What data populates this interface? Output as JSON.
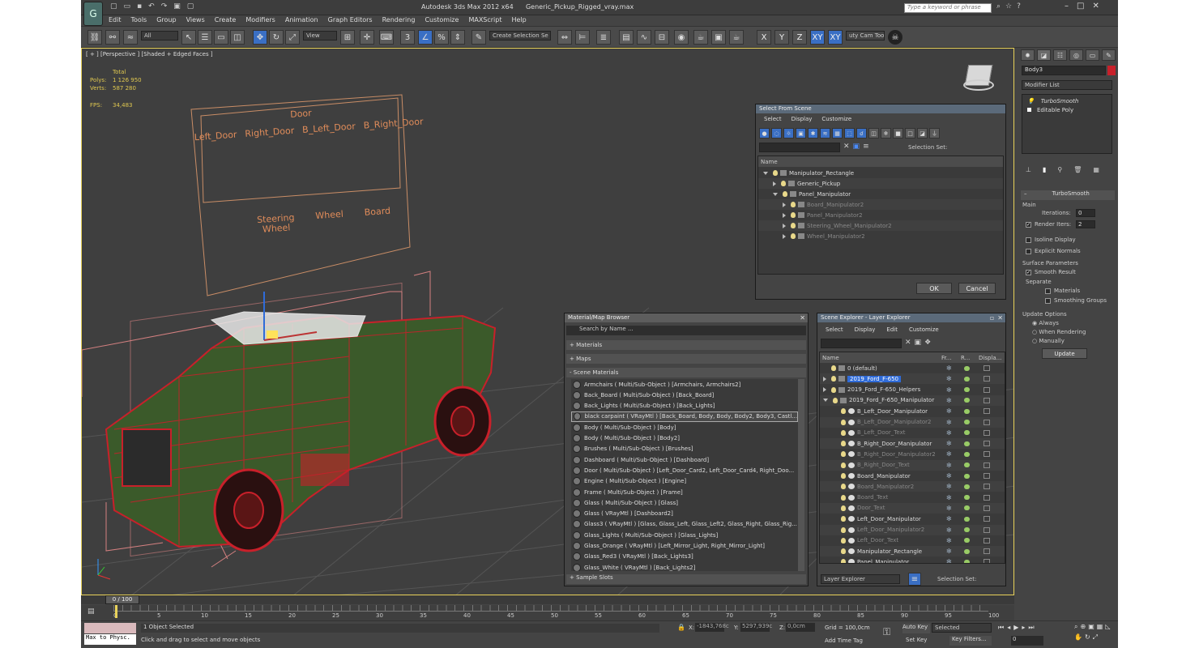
{
  "app": {
    "title": "Autodesk 3ds Max  2012 x64",
    "file": "Generic_Pickup_Rigged_vray.max",
    "search_placeholder": "Type a keyword or phrase"
  },
  "menu": [
    "Edit",
    "Tools",
    "Group",
    "Views",
    "Create",
    "Modifiers",
    "Animation",
    "Graph Editors",
    "Rendering",
    "Customize",
    "MAXScript",
    "Help"
  ],
  "toolbar": {
    "filter": "All",
    "refcoord": "View",
    "selset": "Create Selection Se",
    "axes": [
      "X",
      "Y",
      "Z",
      "XY",
      "XY"
    ],
    "cam_tool": "uty Cam Tool",
    "snap": "3"
  },
  "viewport": {
    "label": "[ + ] [Perspective ] [Shaded + Edged Faces ]",
    "stats": {
      "total": "Total",
      "polys_label": "Polys:",
      "polys": "1 126 950",
      "verts_label": "Verts:",
      "verts": "587 280",
      "fps_label": "FPS:",
      "fps": "34,483"
    },
    "panel": {
      "door": "Door",
      "labels": [
        "Left_Door",
        "Right_Door",
        "B_Left_Door",
        "B_Right_Door"
      ],
      "lower": [
        "Steering\nWheel",
        "Wheel",
        "Board"
      ]
    }
  },
  "select_scene": {
    "title": "Select From Scene",
    "menu": [
      "Select",
      "Display",
      "Customize"
    ],
    "selset": "Selection Set:",
    "col": "Name",
    "items": [
      {
        "n": "Manipulator_Rectangle",
        "d": 0,
        "g": false,
        "o": "down"
      },
      {
        "n": "Generic_Pickup",
        "d": 1,
        "g": false,
        "o": "right"
      },
      {
        "n": "Panel_Manipulator",
        "d": 1,
        "g": false,
        "o": "down"
      },
      {
        "n": "Board_Manipulator2",
        "d": 2,
        "g": true,
        "o": "right"
      },
      {
        "n": "Panel_Manipulator2",
        "d": 2,
        "g": true,
        "o": "right"
      },
      {
        "n": "Steering_Wheel_Manipulator2",
        "d": 2,
        "g": true,
        "o": "right"
      },
      {
        "n": "Wheel_Manipulator2",
        "d": 2,
        "g": true,
        "o": "right"
      }
    ],
    "ok": "OK",
    "cancel": "Cancel"
  },
  "mat_browser": {
    "title": "Material/Map Browser",
    "search": "Search by Name ...",
    "sections": [
      "+ Materials",
      "+ Maps",
      "- Scene Materials"
    ],
    "slots": "+ Sample Slots",
    "items": [
      "Armchairs  ( Multi/Sub-Object ) [Armchairs, Armchairs2]",
      "Back_Board  ( Multi/Sub-Object ) [Back_Board]",
      "Back_Lights  ( Multi/Sub-Object ) [Back_Lights]",
      "black carpaint  ( VRayMtl ) [Back_Board, Body, Body, Body2, Body3, Castl...",
      "Body  ( Multi/Sub-Object ) [Body]",
      "Body  ( Multi/Sub-Object ) [Body2]",
      "Brushes  ( Multi/Sub-Object ) [Brushes]",
      "Dashboard  ( Multi/Sub-Object ) [Dashboard]",
      "Door  ( Multi/Sub-Object ) [Left_Door_Card2, Left_Door_Card4, Right_Doo...",
      "Engine  ( Multi/Sub-Object ) [Engine]",
      "Frame  ( Multi/Sub-Object ) [Frame]",
      "Glass  ( Multi/Sub-Object ) [Glass]",
      "Glass  ( VRayMtl ) [Dashboard2]",
      "Glass3  ( VRayMtl ) [Glass, Glass_Left, Glass_Left2, Glass_Right, Glass_Rig...",
      "Glass_Lights  ( Multi/Sub-Object ) [Glass_Lights]",
      "Glass_Orange  ( VRayMtl ) [Left_Mirror_Light, Right_Mirror_Light]",
      "Glass_Red3  ( VRayMtl ) [Back_Lights3]",
      "Glass_White  ( VRayMtl ) [Back_Lights2]"
    ]
  },
  "scene_explorer": {
    "title": "Scene Explorer - Layer Explorer",
    "menu": [
      "Select",
      "Display",
      "Edit",
      "Customize"
    ],
    "cols": [
      "Name",
      "Fr...",
      "R...",
      "Displa..."
    ],
    "items": [
      {
        "n": "0 (default)",
        "d": 0,
        "t": "layer",
        "g": false,
        "o": ""
      },
      {
        "n": "2019_Ford_F-650",
        "d": 0,
        "t": "layer",
        "g": false,
        "o": "right",
        "sel": true
      },
      {
        "n": "2019_Ford_F-650_Helpers",
        "d": 0,
        "t": "layer",
        "g": false,
        "o": "right"
      },
      {
        "n": "2019_Ford_F-650_Manipulator",
        "d": 0,
        "t": "layer",
        "g": false,
        "o": "down"
      },
      {
        "n": "B_Left_Door_Manipulator",
        "d": 1,
        "t": "obj",
        "g": false,
        "o": ""
      },
      {
        "n": "B_Left_Door_Manipulator2",
        "d": 1,
        "t": "obj",
        "g": true,
        "o": ""
      },
      {
        "n": "B_Left_Door_Text",
        "d": 1,
        "t": "obj",
        "g": true,
        "o": ""
      },
      {
        "n": "B_Right_Door_Manipulator",
        "d": 1,
        "t": "obj",
        "g": false,
        "o": ""
      },
      {
        "n": "B_Right_Door_Manipulator2",
        "d": 1,
        "t": "obj",
        "g": true,
        "o": ""
      },
      {
        "n": "B_Right_Door_Text",
        "d": 1,
        "t": "obj",
        "g": true,
        "o": ""
      },
      {
        "n": "Board_Manipulator",
        "d": 1,
        "t": "obj",
        "g": false,
        "o": ""
      },
      {
        "n": "Board_Manipulator2",
        "d": 1,
        "t": "obj",
        "g": true,
        "o": ""
      },
      {
        "n": "Board_Text",
        "d": 1,
        "t": "obj",
        "g": true,
        "o": ""
      },
      {
        "n": "Door_Text",
        "d": 1,
        "t": "obj",
        "g": true,
        "o": ""
      },
      {
        "n": "Left_Door_Manipulator",
        "d": 1,
        "t": "obj",
        "g": false,
        "o": ""
      },
      {
        "n": "Left_Door_Manipulator2",
        "d": 1,
        "t": "obj",
        "g": true,
        "o": ""
      },
      {
        "n": "Left_Door_Text",
        "d": 1,
        "t": "obj",
        "g": true,
        "o": ""
      },
      {
        "n": "Manipulator_Rectangle",
        "d": 1,
        "t": "obj",
        "g": false,
        "o": ""
      },
      {
        "n": "Panel_Manipulator",
        "d": 1,
        "t": "obj",
        "g": false,
        "o": ""
      }
    ],
    "footer": "Layer Explorer",
    "selset": "Selection Set:"
  },
  "cmd_panel": {
    "object": "Body3",
    "modlist": "Modifier List",
    "stack": [
      "TurboSmooth",
      "Editable Poly"
    ],
    "rollout": "TurboSmooth",
    "main": "Main",
    "iter_label": "Iterations:",
    "iter": "0",
    "render_label": "Render Iters:",
    "render": "2",
    "isoline": "Isoline Display",
    "explicit": "Explicit Normals",
    "surface": "Surface Parameters",
    "smooth": "Smooth Result",
    "separate": "Separate",
    "materials": "Materials",
    "smoothing": "Smoothing Groups",
    "update_opts": "Update Options",
    "always": "Always",
    "when_render": "When Rendering",
    "manually": "Manually",
    "update": "Update"
  },
  "timeline": {
    "range": "0 / 100",
    "ticks": [
      "0",
      "5",
      "10",
      "15",
      "20",
      "25",
      "30",
      "35",
      "40",
      "45",
      "50",
      "55",
      "60",
      "65",
      "70",
      "75",
      "80",
      "85",
      "90",
      "95",
      "100"
    ]
  },
  "status": {
    "maxscript": "Max to Physc.",
    "selected": "1 Object Selected",
    "prompt": "Click and drag to select and move objects",
    "x_label": "X:",
    "x": "-1843,768c",
    "y_label": "Y:",
    "y": "5297,939c",
    "z_label": "Z:",
    "z": "0,0cm",
    "grid": "Grid = 100,0cm",
    "add_time": "Add Time Tag",
    "autokey": "Auto Key",
    "setkey": "Set Key",
    "keymode": "Selected",
    "keyfilters": "Key Filters...",
    "frame": "0"
  },
  "colors": {
    "accent": "#2f6bd8",
    "ui": "#444444",
    "dark": "#2b2b2b",
    "wire": "#c8202a",
    "model": "#3b5a2a"
  }
}
